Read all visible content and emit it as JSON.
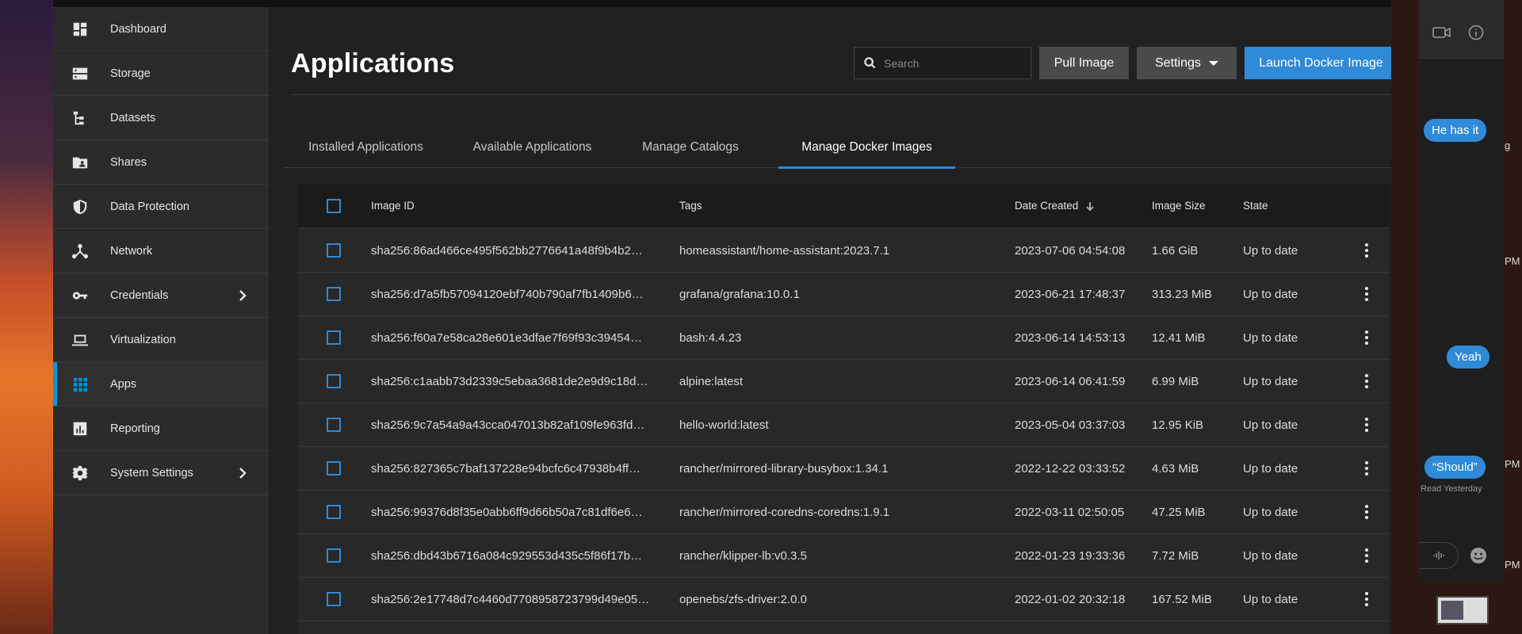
{
  "sidebar": {
    "items": [
      {
        "label": "Dashboard",
        "icon": "dashboard-icon"
      },
      {
        "label": "Storage",
        "icon": "storage-icon"
      },
      {
        "label": "Datasets",
        "icon": "datasets-icon"
      },
      {
        "label": "Shares",
        "icon": "shares-icon"
      },
      {
        "label": "Data Protection",
        "icon": "shield-icon"
      },
      {
        "label": "Network",
        "icon": "network-icon"
      },
      {
        "label": "Credentials",
        "icon": "key-icon"
      },
      {
        "label": "Virtualization",
        "icon": "laptop-icon"
      },
      {
        "label": "Apps",
        "icon": "apps-grid-icon"
      },
      {
        "label": "Reporting",
        "icon": "reporting-icon"
      },
      {
        "label": "System Settings",
        "icon": "gear-icon"
      }
    ],
    "active": "Apps",
    "accent": "#0095d5"
  },
  "header": {
    "title": "Applications",
    "search_placeholder": "Search",
    "pull_image_label": "Pull Image",
    "settings_label": "Settings",
    "launch_label": "Launch Docker Image"
  },
  "tabs": [
    {
      "label": "Installed Applications"
    },
    {
      "label": "Available Applications"
    },
    {
      "label": "Manage Catalogs"
    },
    {
      "label": "Manage Docker Images"
    }
  ],
  "active_tab": "Manage Docker Images",
  "table": {
    "columns": {
      "image_id": "Image ID",
      "tags": "Tags",
      "date_created": "Date Created",
      "image_size": "Image Size",
      "state": "State"
    },
    "sort": {
      "column": "Date Created",
      "direction": "descending"
    },
    "rows": [
      {
        "id": "sha256:86ad466ce495f562bb2776641a48f9b4b2…",
        "tags": "homeassistant/home-assistant:2023.7.1",
        "date": "2023-07-06 04:54:08",
        "size": "1.66 GiB",
        "state": "Up to date"
      },
      {
        "id": "sha256:d7a5fb57094120ebf740b790af7fb1409b6…",
        "tags": "grafana/grafana:10.0.1",
        "date": "2023-06-21 17:48:37",
        "size": "313.23 MiB",
        "state": "Up to date"
      },
      {
        "id": "sha256:f60a7e58ca28e601e3dfae7f69f93c39454…",
        "tags": "bash:4.4.23",
        "date": "2023-06-14 14:53:13",
        "size": "12.41 MiB",
        "state": "Up to date"
      },
      {
        "id": "sha256:c1aabb73d2339c5ebaa3681de2e9d9c18d…",
        "tags": "alpine:latest",
        "date": "2023-06-14 06:41:59",
        "size": "6.99 MiB",
        "state": "Up to date"
      },
      {
        "id": "sha256:9c7a54a9a43cca047013b82af109fe963fd…",
        "tags": "hello-world:latest",
        "date": "2023-05-04 03:37:03",
        "size": "12.95 KiB",
        "state": "Up to date"
      },
      {
        "id": "sha256:827365c7baf137228e94bcfc6c47938b4ff…",
        "tags": "rancher/mirrored-library-busybox:1.34.1",
        "date": "2022-12-22 03:33:52",
        "size": "4.63 MiB",
        "state": "Up to date"
      },
      {
        "id": "sha256:99376d8f35e0abb6ff9d66b50a7c81df6e6…",
        "tags": "rancher/mirrored-coredns-coredns:1.9.1",
        "date": "2022-03-11 02:50:05",
        "size": "47.25 MiB",
        "state": "Up to date"
      },
      {
        "id": "sha256:dbd43b6716a084c929553d435c5f86f17b…",
        "tags": "rancher/klipper-lb:v0.3.5",
        "date": "2022-01-23 19:33:36",
        "size": "7.72 MiB",
        "state": "Up to date"
      },
      {
        "id": "sha256:2e17748d7c4460d7708958723799d49e05…",
        "tags": "openebs/zfs-driver:2.0.0",
        "date": "2022-01-02 20:32:18",
        "size": "167.52 MiB",
        "state": "Up to date"
      }
    ]
  },
  "messages": {
    "bubbles": [
      "He has it",
      "Yeah",
      "“Should”"
    ],
    "read_note": "Read Yesterday",
    "bubble_color": "#2f8ad8"
  },
  "edge_text": [
    "g",
    "PM",
    "PM",
    "PM"
  ]
}
